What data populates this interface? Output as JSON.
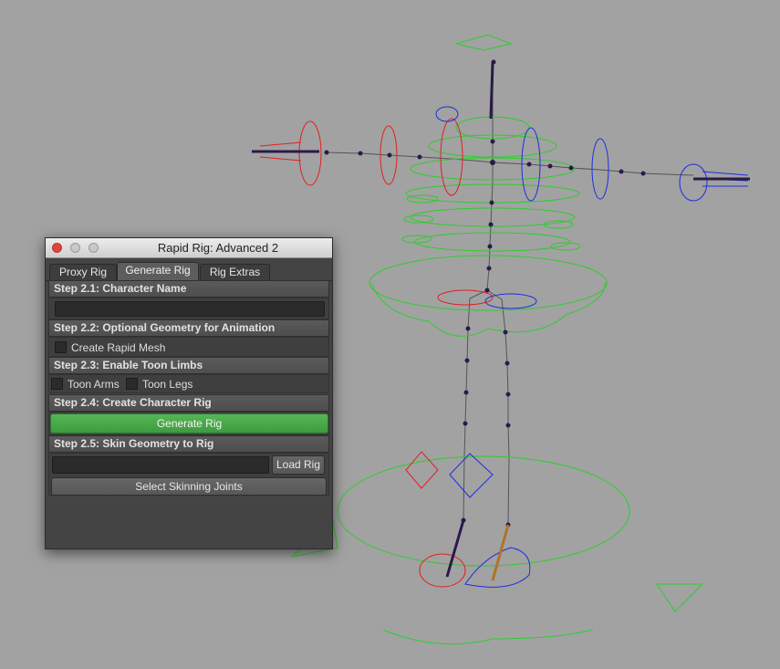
{
  "window": {
    "title": "Rapid Rig: Advanced 2"
  },
  "tabs": [
    {
      "label": "Proxy Rig",
      "active": false
    },
    {
      "label": "Generate Rig",
      "active": true
    },
    {
      "label": "Rig Extras",
      "active": false
    }
  ],
  "steps": {
    "step1": {
      "header": "Step 2.1: Character Name",
      "name_value": ""
    },
    "step2": {
      "header": "Step 2.2: Optional Geometry for Animation",
      "checkbox_label": "Create Rapid Mesh",
      "checked": false
    },
    "step3": {
      "header": "Step 2.3: Enable Toon Limbs",
      "arms_label": "Toon Arms",
      "legs_label": "Toon Legs",
      "arms_checked": false,
      "legs_checked": false
    },
    "step4": {
      "header": "Step 2.4: Create Character Rig",
      "button_label": "Generate Rig"
    },
    "step5": {
      "header": "Step 2.5: Skin Geometry to Rig",
      "field_value": "",
      "load_button": "Load Rig",
      "select_button": "Select Skinning Joints"
    }
  },
  "viewport": {
    "background": "#a2a2a2",
    "colors": {
      "center": "#2ecc2e",
      "left": "#e02020",
      "right": "#1e2ee0",
      "joint": "#2a1a4a",
      "bone": "#5a5a5a"
    }
  }
}
